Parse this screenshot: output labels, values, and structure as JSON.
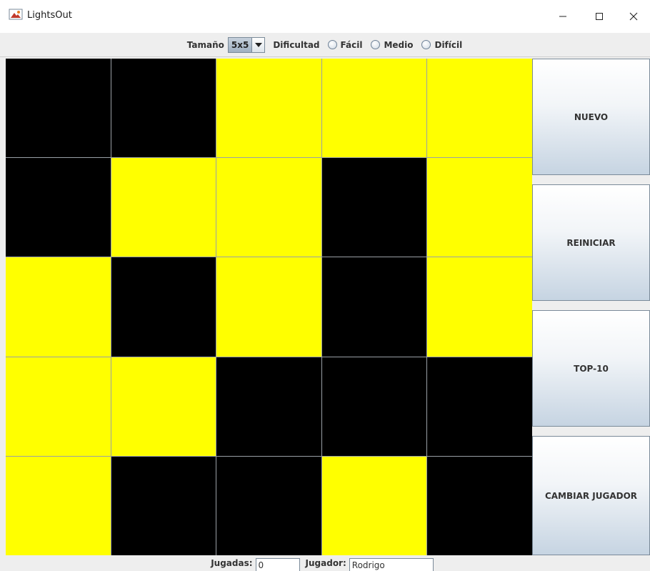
{
  "window": {
    "title": "LightsOut",
    "icon": "java-app-icon"
  },
  "toolbar": {
    "size_label": "Tamaño",
    "size_value": "5x5",
    "difficulty_label": "Dificultad",
    "difficulties": [
      "Fácil",
      "Medio",
      "Difícil"
    ],
    "selected_difficulty": null
  },
  "board": {
    "rows": 5,
    "cols": 5,
    "on_color": "#ffff00",
    "off_color": "#000000",
    "cells": [
      [
        0,
        0,
        1,
        1,
        1
      ],
      [
        0,
        1,
        1,
        0,
        1
      ],
      [
        1,
        0,
        1,
        0,
        1
      ],
      [
        1,
        1,
        0,
        0,
        0
      ],
      [
        1,
        0,
        0,
        1,
        0
      ]
    ]
  },
  "buttons": {
    "new": "NUEVO",
    "restart": "REINICIAR",
    "top10": "TOP-10",
    "change_player": "CAMBIAR JUGADOR"
  },
  "status": {
    "moves_label": "Jugadas:",
    "moves_value": "0",
    "player_label": "Jugador:",
    "player_value": "Rodrigo"
  }
}
